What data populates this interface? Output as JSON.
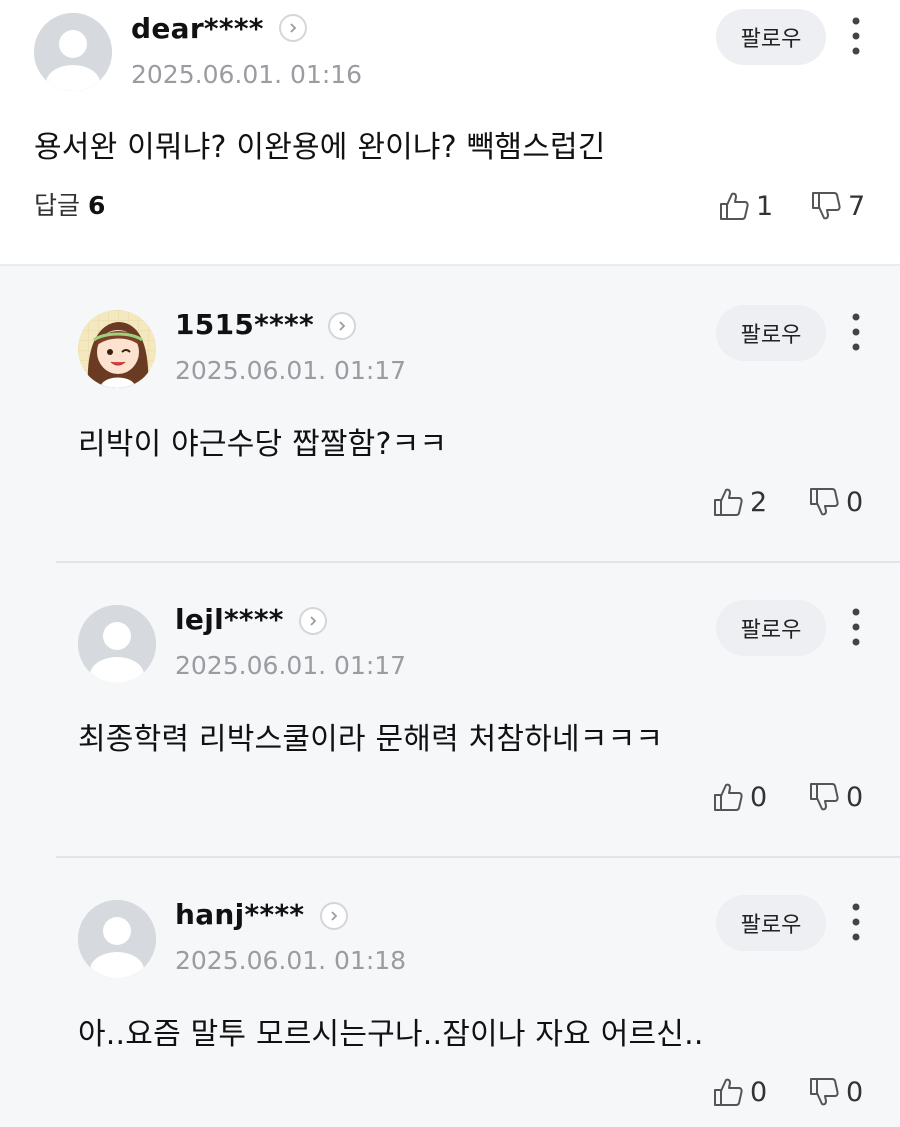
{
  "follow_label": "팔로우",
  "comment": {
    "username": "dear****",
    "timestamp": "2025.06.01. 01:16",
    "text": "용서완 이뭐냐? 이완용에 완이냐? 빽햄스럽긴",
    "reply_label": "답글",
    "reply_count": "6",
    "likes": "1",
    "dislikes": "7",
    "avatar": "default-avatar-icon"
  },
  "replies": [
    {
      "username": "1515****",
      "timestamp": "2025.06.01. 01:17",
      "text": "리박이 야근수당 짭짤함?ㅋㅋ",
      "likes": "2",
      "dislikes": "0",
      "avatar": "cartoon-girl-avatar"
    },
    {
      "username": "lejl****",
      "timestamp": "2025.06.01. 01:17",
      "text": "최종학력 리박스쿨이라 문해력 처참하네ㅋㅋㅋ",
      "likes": "0",
      "dislikes": "0",
      "avatar": "default-avatar-icon"
    },
    {
      "username": "hanj****",
      "timestamp": "2025.06.01. 01:18",
      "text": "아..요즘 말투 모르시는구나..잠이나 자요 어르신..",
      "likes": "0",
      "dislikes": "0",
      "avatar": "default-avatar-icon"
    }
  ],
  "colors": {
    "background": "#ffffff",
    "reply_background": "#f6f7f9",
    "follow_button_bg": "#eeeff2",
    "timestamp": "#9a9ca1",
    "avatar_gray": "#d6d9de"
  }
}
